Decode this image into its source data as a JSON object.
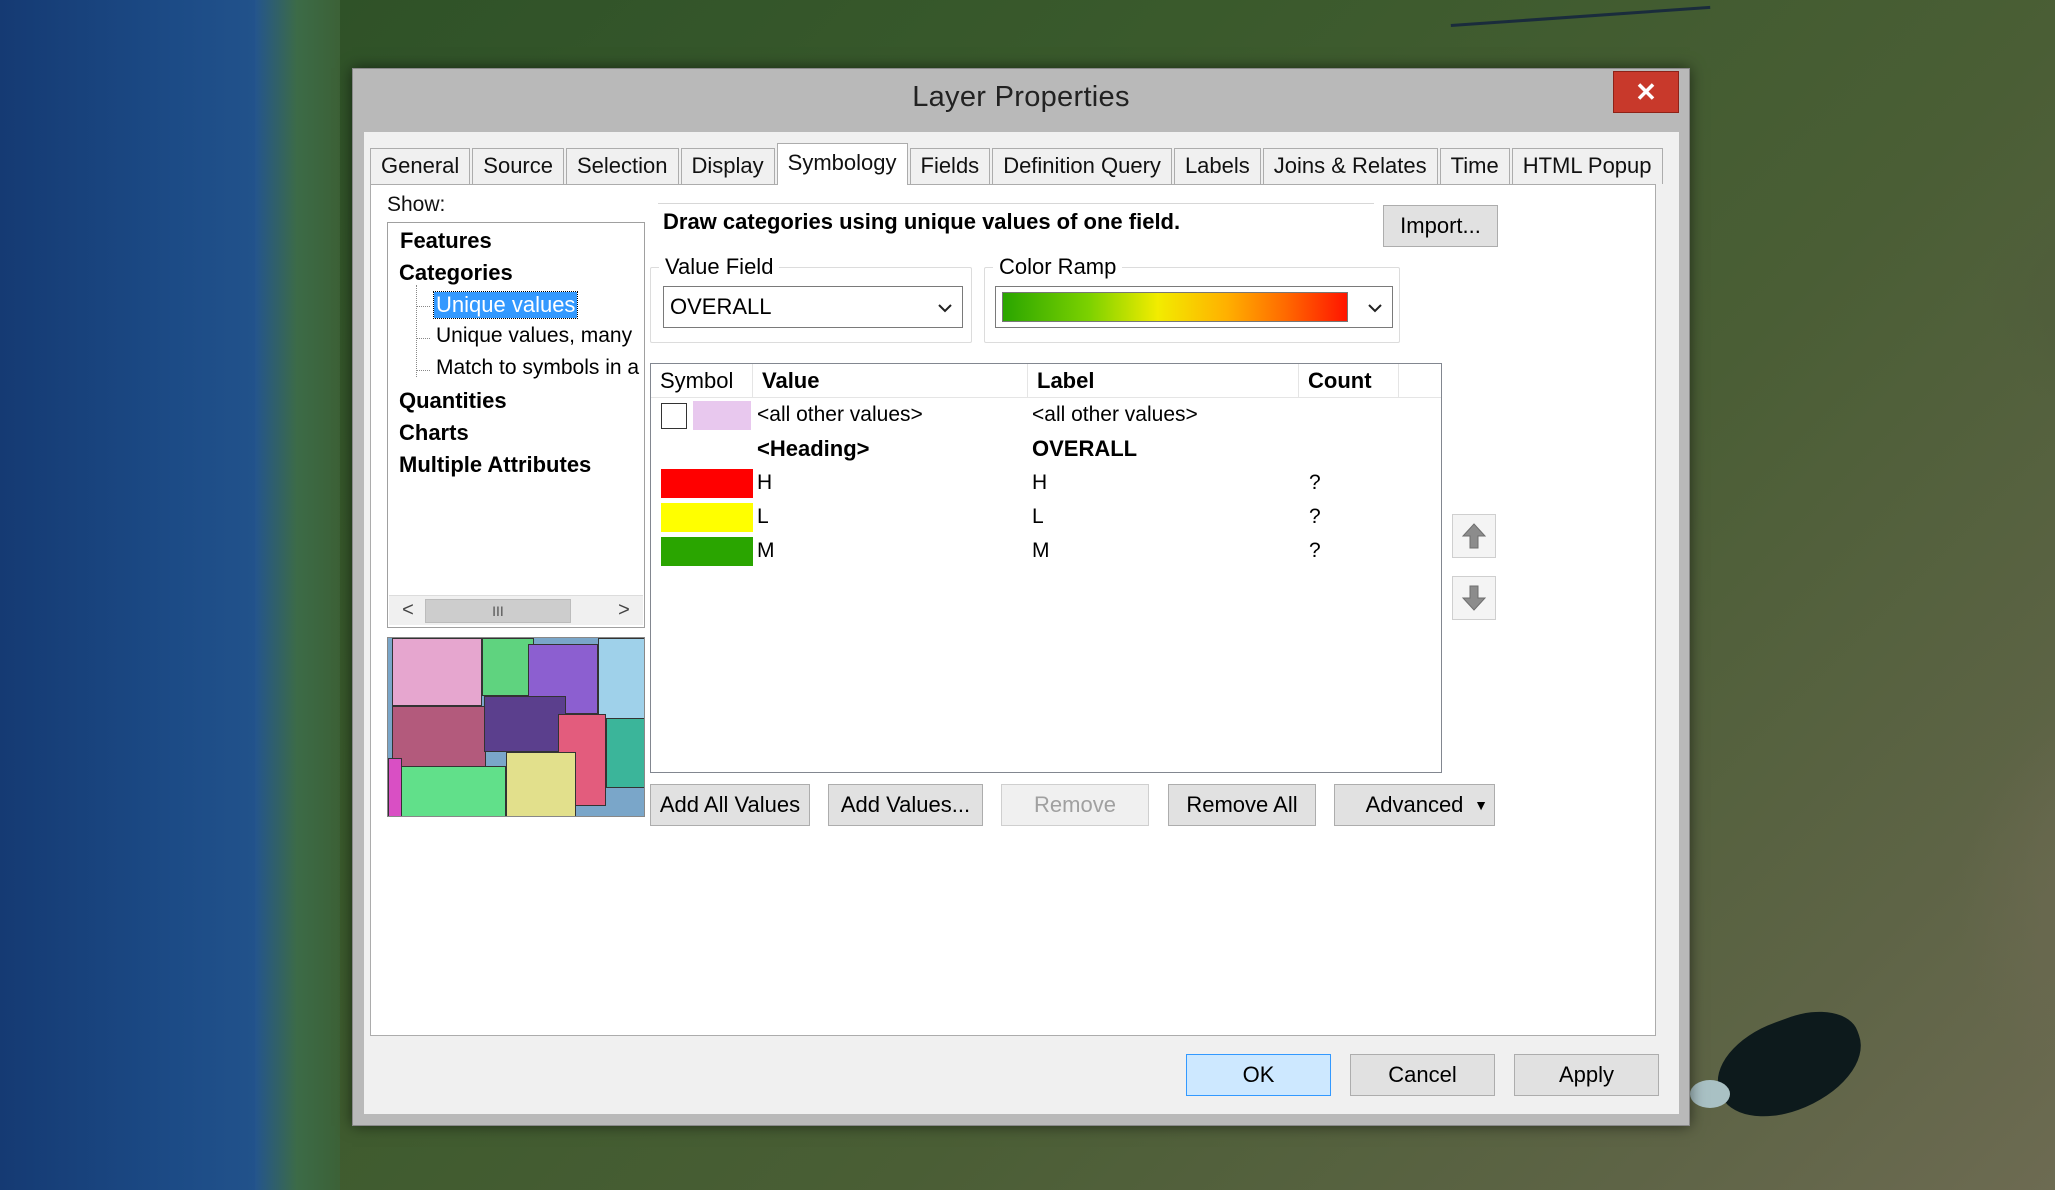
{
  "window": {
    "title": "Layer Properties",
    "close_glyph": "✕"
  },
  "tabs": [
    {
      "label": "General"
    },
    {
      "label": "Source"
    },
    {
      "label": "Selection"
    },
    {
      "label": "Display"
    },
    {
      "label": "Symbology",
      "active": true
    },
    {
      "label": "Fields"
    },
    {
      "label": "Definition Query"
    },
    {
      "label": "Labels"
    },
    {
      "label": "Joins & Relates"
    },
    {
      "label": "Time"
    },
    {
      "label": "HTML Popup"
    }
  ],
  "show": {
    "label": "Show:",
    "items": {
      "features": "Features",
      "categories": "Categories",
      "unique_values": "Unique values",
      "unique_values_many": "Unique values, many",
      "match_symbols": "Match to symbols in a",
      "quantities": "Quantities",
      "charts": "Charts",
      "multiple_attributes": "Multiple Attributes"
    },
    "scroll": {
      "left": "<",
      "thumb": "III",
      "right": ">"
    }
  },
  "description": "Draw categories using unique values of one field.",
  "import_button": "Import...",
  "value_field": {
    "label": "Value Field",
    "selected": "OVERALL"
  },
  "color_ramp": {
    "label": "Color Ramp",
    "colors": [
      "#2aa500",
      "#f2ec00",
      "#ff1500"
    ]
  },
  "symbol_list": {
    "columns": {
      "symbol": "Symbol",
      "value": "Value",
      "label": "Label",
      "count": "Count"
    },
    "rows": [
      {
        "value": "<all other values>",
        "label": "<all other values>",
        "count": "",
        "color": "#e8c8ee",
        "checkbox": true
      },
      {
        "value": "<Heading>",
        "label": "OVERALL",
        "count": "",
        "heading": true
      },
      {
        "value": "H",
        "label": "H",
        "count": "?",
        "color": "#ff0000"
      },
      {
        "value": "L",
        "label": "L",
        "count": "?",
        "color": "#ffff00"
      },
      {
        "value": "M",
        "label": "M",
        "count": "?",
        "color": "#2aa500"
      }
    ]
  },
  "buttons": {
    "add_all_values": "Add All Values",
    "add_values": "Add Values...",
    "remove": "Remove",
    "remove_all": "Remove All",
    "advanced": "Advanced",
    "ok": "OK",
    "cancel": "Cancel",
    "apply": "Apply"
  }
}
